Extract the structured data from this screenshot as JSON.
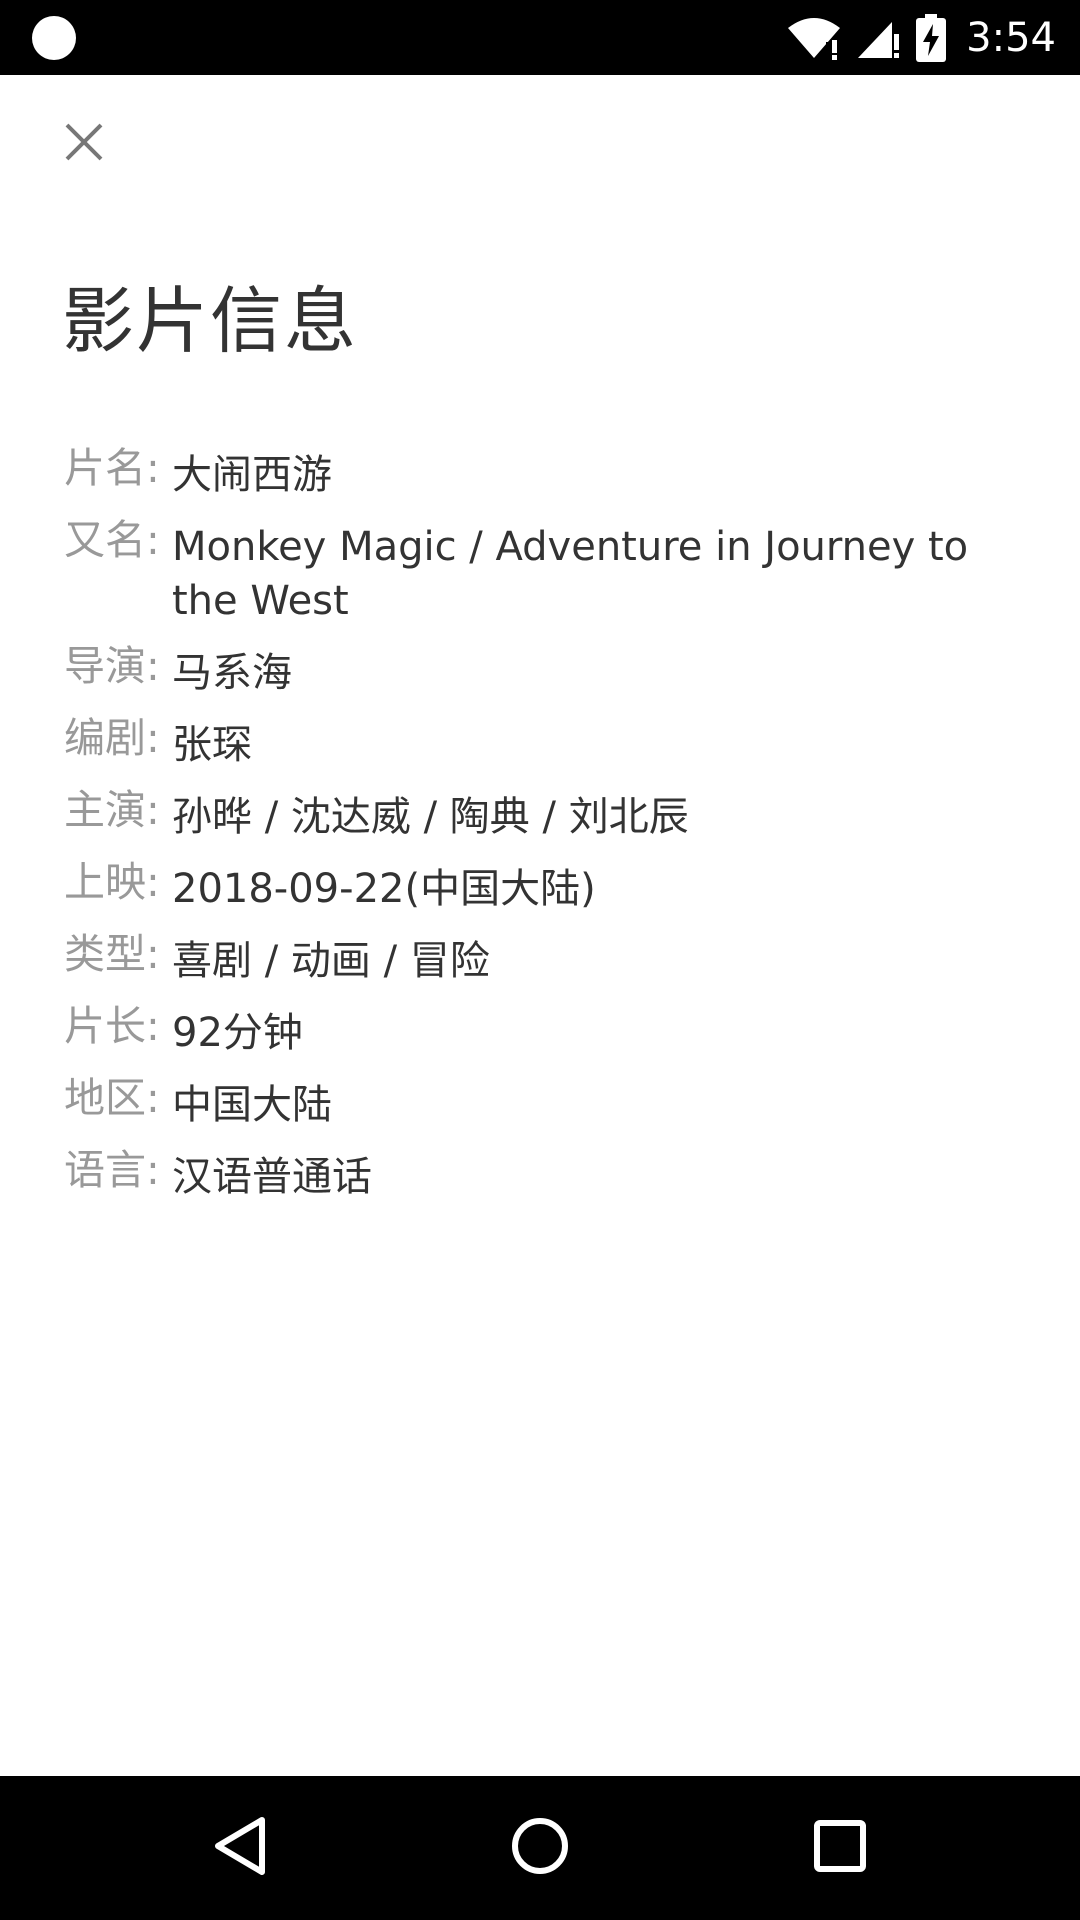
{
  "status_bar": {
    "time": "3:54"
  },
  "header": {
    "title": "影片信息"
  },
  "info": [
    {
      "label": "片名:",
      "value": "大闹西游"
    },
    {
      "label": "又名:",
      "value": "Monkey Magic / Adventure in Journey to the West"
    },
    {
      "label": "导演:",
      "value": "马系海"
    },
    {
      "label": "编剧:",
      "value": "张琛"
    },
    {
      "label": "主演:",
      "value": "孙晔 / 沈达威 / 陶典 / 刘北辰"
    },
    {
      "label": "上映:",
      "value": "2018-09-22(中国大陆)"
    },
    {
      "label": "类型:",
      "value": "喜剧 / 动画 / 冒险"
    },
    {
      "label": "片长:",
      "value": "92分钟"
    },
    {
      "label": "地区:",
      "value": "中国大陆"
    },
    {
      "label": "语言:",
      "value": "汉语普通话"
    }
  ],
  "icons": {
    "close": "close-icon",
    "back": "back-icon",
    "home": "home-icon",
    "recents": "recents-icon",
    "wifi": "wifi-icon",
    "signal": "signal-icon",
    "battery": "battery-charging-icon"
  },
  "colors": {
    "label": "#999999",
    "value": "#333333",
    "title": "#333333",
    "bars": "#000000"
  }
}
